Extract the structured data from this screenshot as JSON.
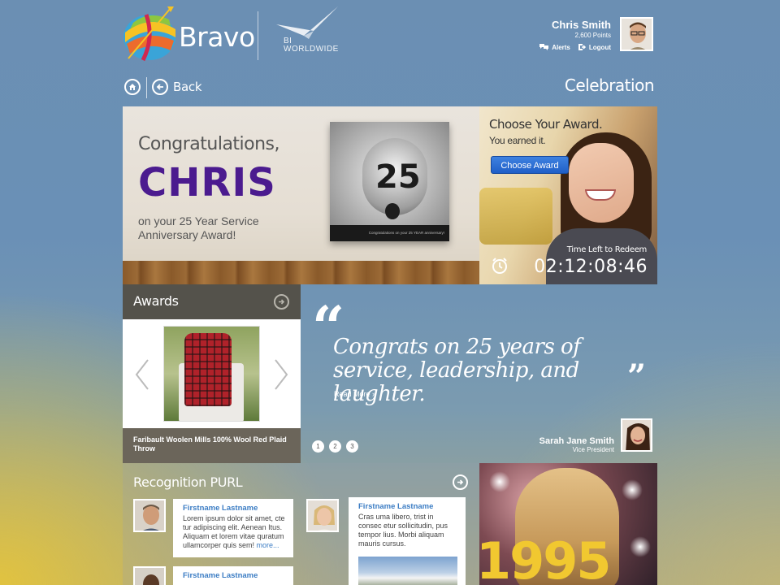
{
  "brand": {
    "name": "Bravo",
    "partner": "BI\nWORLDWIDE"
  },
  "user": {
    "name": "Chris Smith",
    "points": "2,600 Points",
    "alerts_label": "Alerts",
    "logout_label": "Logout"
  },
  "nav": {
    "back_label": "Back",
    "page_title": "Celebration"
  },
  "hero": {
    "greeting": "Congratulations,",
    "name": "CHRIS",
    "message": "on your 25 Year Service Anniversary Award!",
    "plaque_number": "25",
    "plaque_caption": "Congratulations on your 25 YEAR anniversary!"
  },
  "promo": {
    "title": "Choose Your Award.",
    "subtitle": "You earned it.",
    "button_label": "Choose Award",
    "time_label": "Time Left to Redeem",
    "countdown": "02:12:08:46"
  },
  "awards": {
    "title": "Awards",
    "item_caption": "Faribault Woolen Mills 100% Wool Red Plaid Throw"
  },
  "quote": {
    "open_mark": "“",
    "close_mark": "”",
    "text": "Congrats on 25 years of service, leadership, and laughter.",
    "read_more": "Read More »",
    "pages": [
      "1",
      "2",
      "3"
    ],
    "author_name": "Sarah Jane Smith",
    "author_title": "Vice President"
  },
  "purl": {
    "title": "Recognition PURL",
    "cards": [
      {
        "name": "Firstname Lastname",
        "text": "Lorem ipsum dolor sit amet, cte tur adipiscing elit. Aenean Itus. Aliquam et lorem vitae quratum ullamcorper quis sem!",
        "more": "more..."
      },
      {
        "name": "Firstname Lastname",
        "text": "Cras uma libero, trist in consec etur sollicitudin, pus tempor lius. Morbi aliquam mauris cursus."
      },
      {
        "name": "Firstname Lastname",
        "text": ""
      }
    ]
  },
  "tile": {
    "year": "1995"
  },
  "colors": {
    "accent": "#4b1b8f",
    "button": "#2a6ad6",
    "link": "#3c7dc4",
    "year": "#f1c830"
  }
}
